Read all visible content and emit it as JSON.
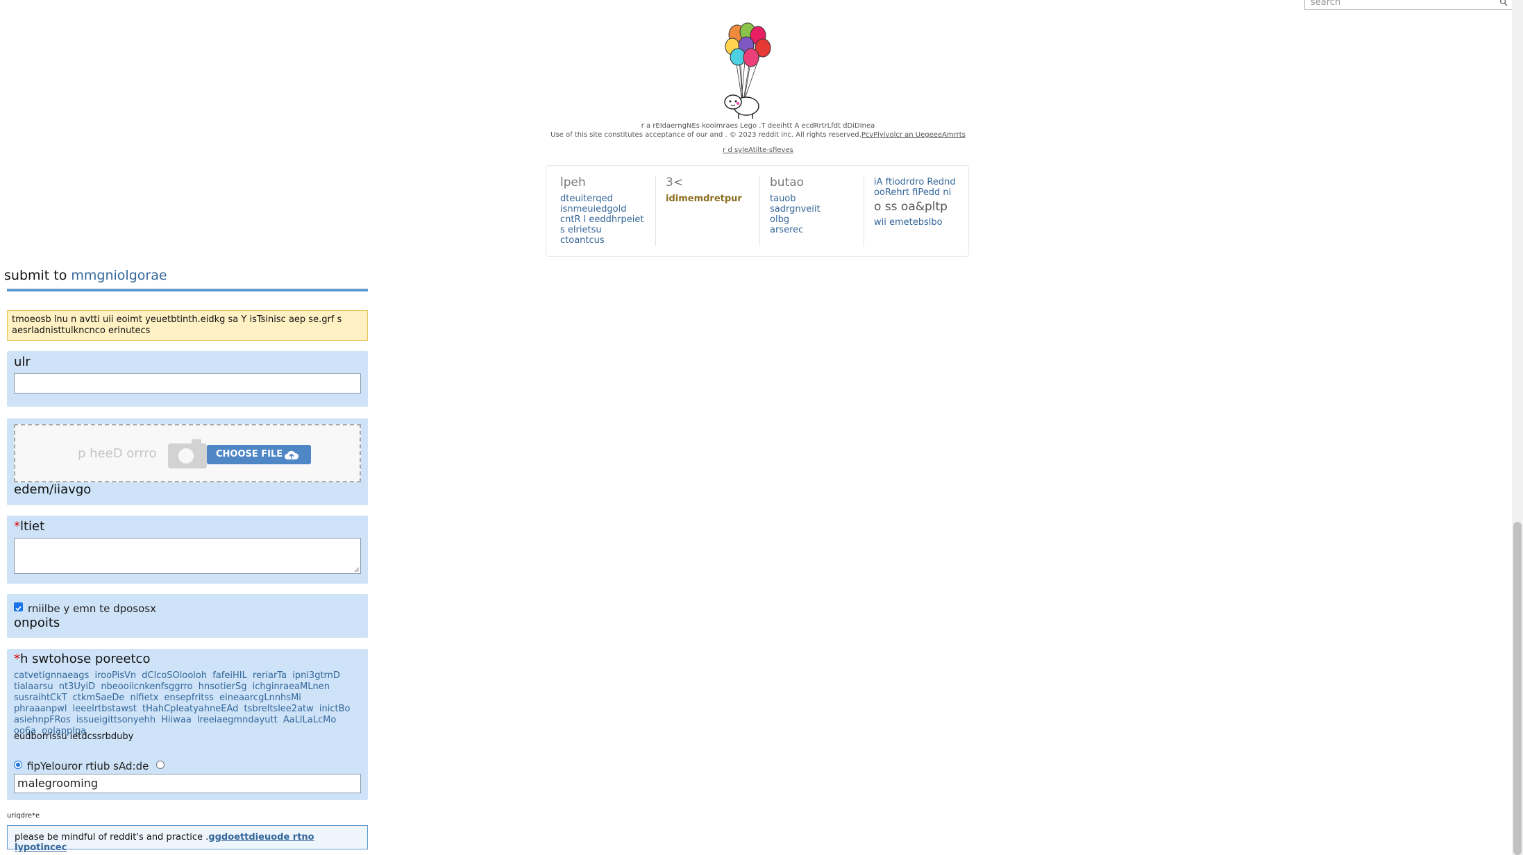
{
  "search": {
    "placeholder": "search"
  },
  "footer": {
    "legal1": "r a rEIdaerngNEs kooimraes Lego .T deeihtt A ecdRrtrLfdt dDiDInea",
    "legal2_text": "Use of this site constitutes acceptance of our and . © 2023 reddit inc. All rights reserved.",
    "legal2_link": "PcvPiyivolcr an UegeeeAmrrts",
    "legal3_link": "r d syleAtilte-sfieves",
    "col1": {
      "heading": "lpeh",
      "links": [
        "dteuiterqed",
        "isnmeuiedgold",
        "cntR l eeddhrpeiet",
        "s elrietsu",
        "ctoantcus"
      ]
    },
    "col2": {
      "heading": "3<",
      "links": [
        "idimemdretpur"
      ]
    },
    "col3": {
      "heading": "butao",
      "links": [
        "tauob",
        "sadrgnveiit",
        "olbg",
        "arserec"
      ]
    },
    "col4": {
      "links_top": [
        "iA ftiodrdro Rednd",
        "ooRehrt fiPedd ni"
      ],
      "mid": "o ss oa&pltp",
      "links_bottom": [
        "wii emetebslbo"
      ]
    }
  },
  "form": {
    "title_prefix": "submit to",
    "title_link": "mmgniolgorae",
    "notice": "tmoeosb lnu n avtti uii eoimt yeuetbtinth.eidkg sa Y isTsinisc aep se.grf s aesrladnisttulkncnco erinutecs",
    "url_label": "ulr",
    "url_value": "",
    "drop_text": "p heeD orrro",
    "choose_file": "CHOOSE FILE",
    "media_label": "edem/iiavgo",
    "title_req": "*",
    "title_label": "ltiet",
    "title_value": "",
    "checkbox_label": "rniilbe y emn te dpososx",
    "checkbox_checked": true,
    "options_label": "onpoits",
    "community_req": "*",
    "community_label": "h swtohose poreetco",
    "subreddits": [
      "catvetignnaeags",
      "irooPisVn",
      "dClcoSOlooloh",
      "fafeiHIL",
      "reriarTa",
      "ipni3gtrnD",
      "tialaarsu",
      "nt3UyiD",
      "nbeooiicnkenfsggrro",
      "hnsotierSg",
      "ichginraeaMLnen",
      "susraihtCkT",
      "ctkmSaeDe",
      "nlfietx",
      "ensepfritss",
      "eineaarcgLnnhsMi",
      "phraaanpwl",
      "leeelrtbstawst",
      "tHahCpleatyahneEAd",
      "tsbreltslee2atw",
      "inictBo",
      "asiehnpFRos",
      "issueigittsonyehh",
      "Hiiwaa",
      "lreeiaegmndayutt",
      "AaLlLaLcMo",
      "oo6a",
      "oolapplpa"
    ],
    "sr_note": "eudborrissu ietdcssrbduby",
    "radio_label": "fipYelouror  rtiub sAd:de",
    "community_value": "malegrooming",
    "required_note": "uriqdre*e",
    "bottom_text": "please be mindful of reddit's and practice .",
    "bottom_link": "ggdoettdieuode rtno lypotincec"
  }
}
